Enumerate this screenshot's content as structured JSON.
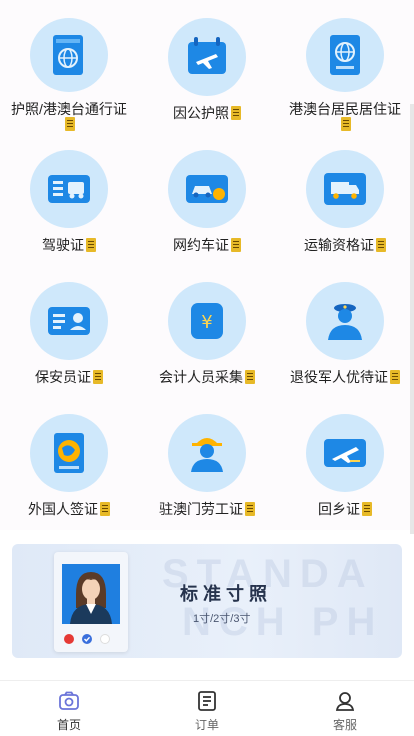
{
  "services": [
    {
      "label": "护照/港澳台通行证",
      "icon": "passport-icon"
    },
    {
      "label": "因公护照",
      "icon": "business-passport-icon"
    },
    {
      "label": "港澳台居民居住证",
      "icon": "residence-permit-icon"
    },
    {
      "label": "驾驶证",
      "icon": "drivers-license-icon"
    },
    {
      "label": "网约车证",
      "icon": "ride-hailing-license-icon"
    },
    {
      "label": "运输资格证",
      "icon": "transport-qualification-icon"
    },
    {
      "label": "保安员证",
      "icon": "security-guard-card-icon"
    },
    {
      "label": "会计人员采集",
      "icon": "accountant-yuan-icon"
    },
    {
      "label": "退役军人优待证",
      "icon": "veteran-icon"
    },
    {
      "label": "外国人签证",
      "icon": "visa-globe-icon"
    },
    {
      "label": "驻澳门劳工证",
      "icon": "worker-helmet-icon"
    },
    {
      "label": "回乡证",
      "icon": "home-return-plane-icon"
    }
  ],
  "banner": {
    "title": "标准寸照",
    "subtitle": "1寸/2寸/3寸",
    "bg_text_1": "STANDA",
    "bg_text_2": "NCH PH",
    "dot_colors": [
      "#e53935",
      "#3a6fdc",
      "#ffffff"
    ]
  },
  "tabs": [
    {
      "label": "首页",
      "icon": "camera-home-icon",
      "active": true
    },
    {
      "label": "订单",
      "icon": "order-icon",
      "active": false
    },
    {
      "label": "客服",
      "icon": "customer-service-icon",
      "active": false
    }
  ],
  "colors": {
    "icon_circle": "#cfe8fb",
    "icon_blue": "#2f8ff0",
    "badge": "#e7b928",
    "tab_active": "#6b74d9"
  }
}
